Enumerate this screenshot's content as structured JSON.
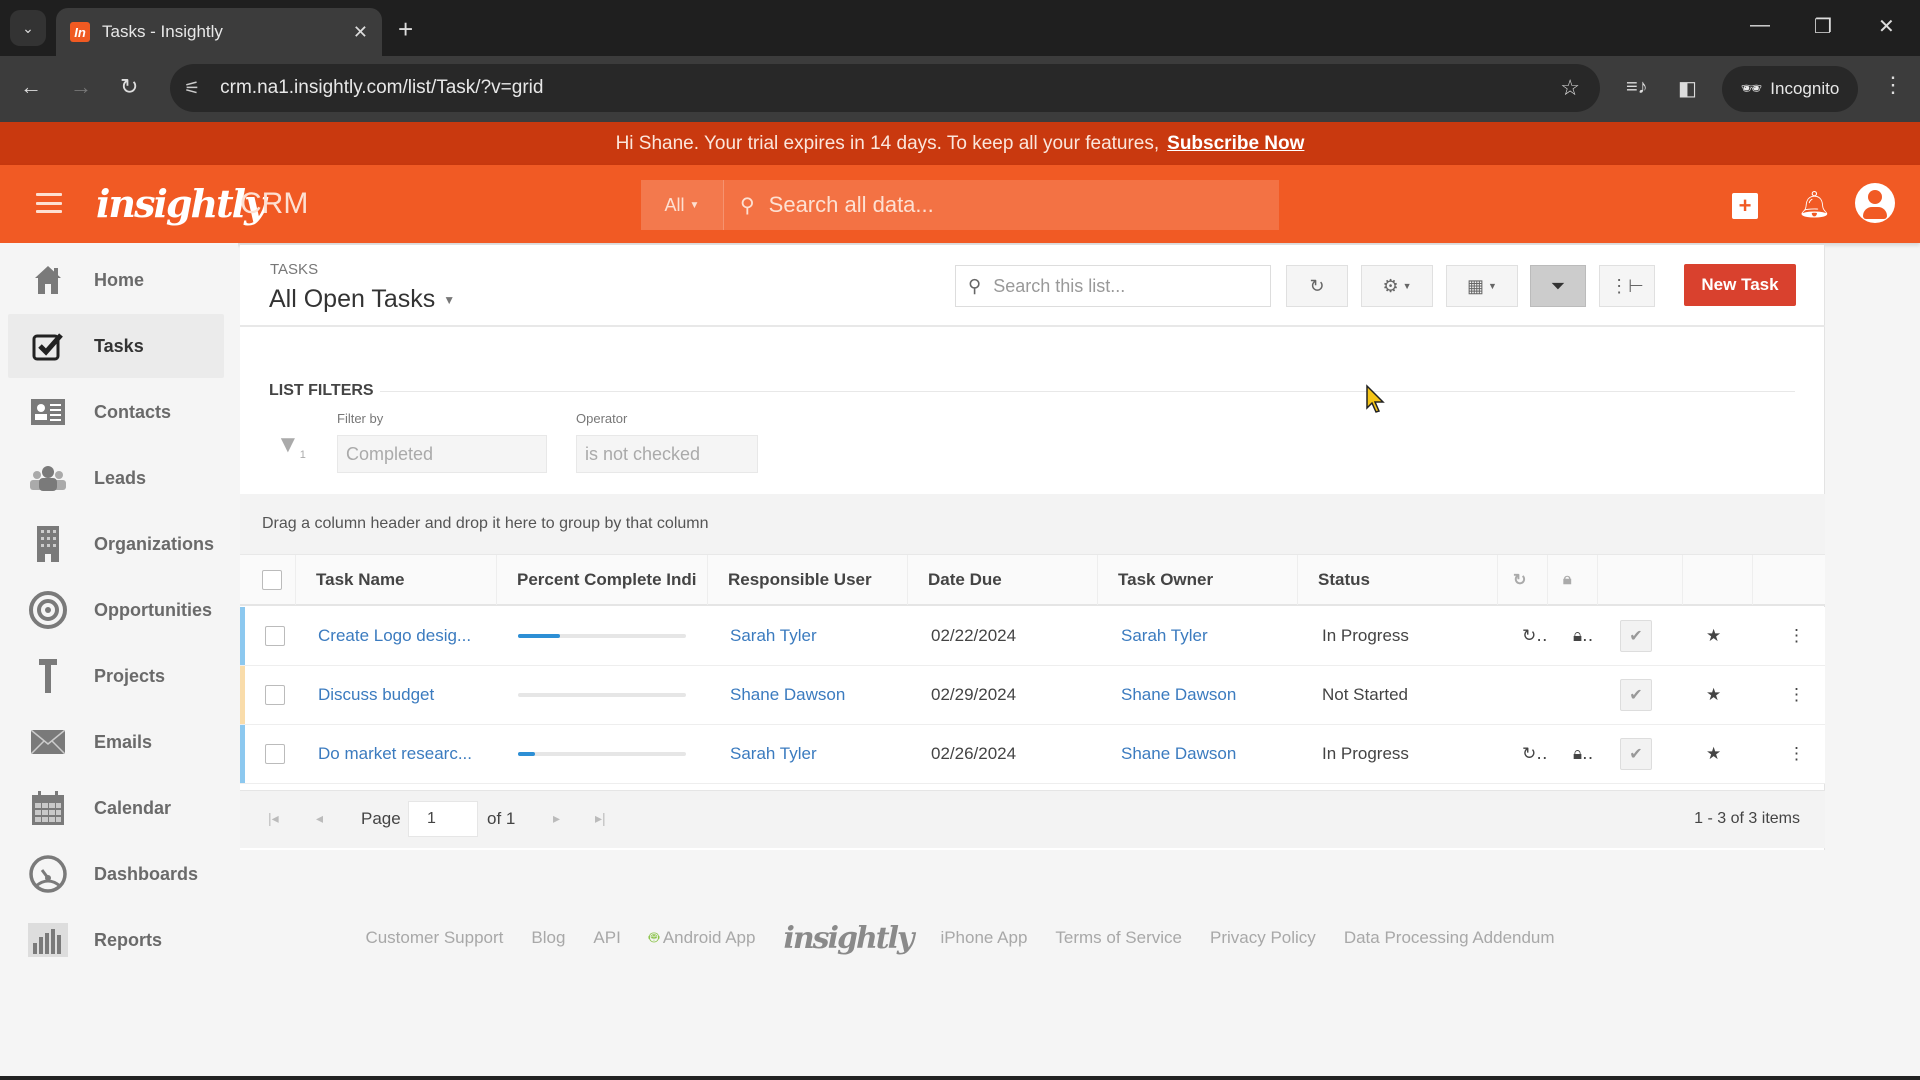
{
  "browser": {
    "tab_title": "Tasks - Insightly",
    "favicon_text": "In",
    "url": "crm.na1.insightly.com/list/Task/?v=grid",
    "incognito_label": "Incognito"
  },
  "trial_banner": {
    "message": "Hi Shane. Your trial expires in 14 days. To keep all your features,",
    "link": "Subscribe Now"
  },
  "header": {
    "logo": "insightly",
    "product": "CRM",
    "search_scope": "All",
    "search_placeholder": "Search all data..."
  },
  "sidebar": {
    "items": [
      {
        "label": "Home",
        "icon": "home-icon"
      },
      {
        "label": "Tasks",
        "icon": "task-check-icon",
        "active": true
      },
      {
        "label": "Contacts",
        "icon": "contact-card-icon"
      },
      {
        "label": "Leads",
        "icon": "leads-icon"
      },
      {
        "label": "Organizations",
        "icon": "building-icon"
      },
      {
        "label": "Opportunities",
        "icon": "target-icon"
      },
      {
        "label": "Projects",
        "icon": "hammer-icon"
      },
      {
        "label": "Emails",
        "icon": "envelope-icon"
      },
      {
        "label": "Calendar",
        "icon": "calendar-icon"
      },
      {
        "label": "Dashboards",
        "icon": "gauge-icon"
      },
      {
        "label": "Reports",
        "icon": "bar-chart-icon"
      }
    ]
  },
  "page": {
    "crumb": "TASKS",
    "view_title": "All Open Tasks",
    "list_search_placeholder": "Search this list...",
    "new_task_label": "New Task"
  },
  "filters": {
    "title": "LIST FILTERS",
    "filter_count": "1",
    "filter_by_label": "Filter by",
    "filter_by_value": "Completed",
    "operator_label": "Operator",
    "operator_value": "is not checked"
  },
  "grid": {
    "group_hint": "Drag a column header and drop it here to group by that column",
    "columns": [
      "Task Name",
      "Percent Complete Indi",
      "Responsible User",
      "Date Due",
      "Task Owner",
      "Status"
    ],
    "rows": [
      {
        "task_name": "Create Logo desig...",
        "percent_complete": 25,
        "responsible_user": "Sarah Tyler",
        "date_due": "02/22/2024",
        "task_owner": "Sarah Tyler",
        "status": "In Progress",
        "stripe_color": "#8cc8ef",
        "recurring": true,
        "private": true
      },
      {
        "task_name": "Discuss budget",
        "percent_complete": 0,
        "responsible_user": "Shane Dawson",
        "date_due": "02/29/2024",
        "task_owner": "Shane Dawson",
        "status": "Not Started",
        "stripe_color": "#f9dcaa",
        "recurring": false,
        "private": false
      },
      {
        "task_name": "Do market researc...",
        "percent_complete": 10,
        "responsible_user": "Sarah Tyler",
        "date_due": "02/26/2024",
        "task_owner": "Shane Dawson",
        "status": "In Progress",
        "stripe_color": "#8cc8ef",
        "recurring": true,
        "private": true
      }
    ]
  },
  "pager": {
    "page_label": "Page",
    "page_value": "1",
    "of_label": "of 1",
    "count": "1 - 3 of 3 items"
  },
  "footer": {
    "links": [
      "Customer Support",
      "Blog",
      "API",
      "Android App",
      "iPhone App",
      "Terms of Service",
      "Privacy Policy",
      "Data Processing Addendum"
    ],
    "logo": "insightly"
  },
  "colors": {
    "brand": "#f15a24",
    "banner": "#c9390f",
    "new_task": "#d9412e",
    "link": "#3b7bbf",
    "progress": "#2d8fd5",
    "star": "#f5c518"
  }
}
